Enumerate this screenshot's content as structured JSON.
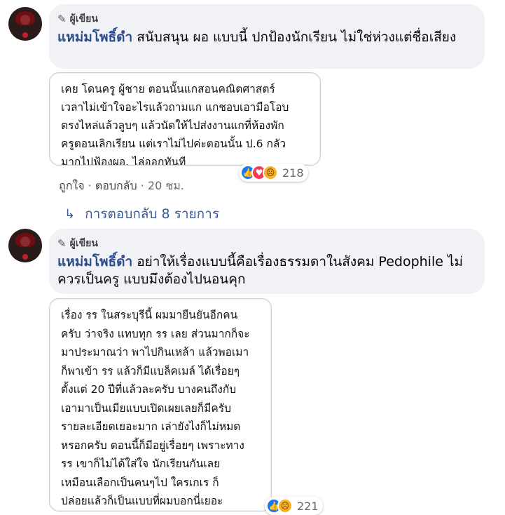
{
  "comments": [
    {
      "badge": "ผู้เขียน",
      "author": "แหม่มโพธิ์ดำ",
      "text": " สนับสนุน ผอ แบบนี้ ปกป้องนักเรียน ไม่ใช่ห่วงแต่ชื่อเสียง",
      "screenshot_text": "เคย โดนครู ผู้ชาย ตอนนั้นแกสอนคณิตศาสตร์\nเวลาไม่เข้าใจอะไรแล้วถามแก  แกชอบเอามือโอบ\nตรงไหล่แล้วลูบๆ  แล้วนัดให้ไปส่งงานแกที่ห้องพัก\nครูตอนเลิกเรียน แต่เราไม่ไปค่ะตอนนั้น ป.6 กลัว\nมากไปฟ้องผอ. ไล่ออกทันที",
      "reaction_count": "218",
      "like_label": "ถูกใจ",
      "reply_label": "ตอบกลับ",
      "time": "20 ชม.",
      "replies_link": "การตอบกลับ 8 รายการ"
    },
    {
      "badge": "ผู้เขียน",
      "author": "แหม่มโพธิ์ดำ",
      "text": " อย่าให้เรื่องแบบนี้คือเรื่องธรรมดาในสังคม Pedophile ไม่ควรเป็นครู แบบมึงต้องไปนอนคุก",
      "screenshot_text": "เรื่อง รร ในสระบุรีนี้ ผมมายืนยันอีกคน\nครับ ว่าจริง แทบทุก รร เลย ส่วนมากก็จะ\nมาประมาณว่า พาไปกินเหล้า แล้วพอเมา\nก็พาเข้า รร แล้วก็มีแบล็คเมล์ ได้เรื่อยๆ\nตั้งแต่ 20 ปีที่แล้วละครับ บางคนถึงกับ\nเอามาเป็นเมียแบบเปิดเผยเลยก็มีครับ\nรายละเอียดเยอะมาก เล่ายังไงก็ไม่หมด\nหรอกครับ ตอนนี้ก็มีอยู่เรื่อยๆ เพราะทาง\nรร เขาก็ไม่ได้ใส่ใจ นักเรียนกันเลย\nเหมือนเลือกเป็นคนๆไป ใครเกเร ก็\nปล่อยแล้วก็เป็นแบบที่ผมบอกนี่เยอะ",
      "reaction_count": "221"
    }
  ]
}
